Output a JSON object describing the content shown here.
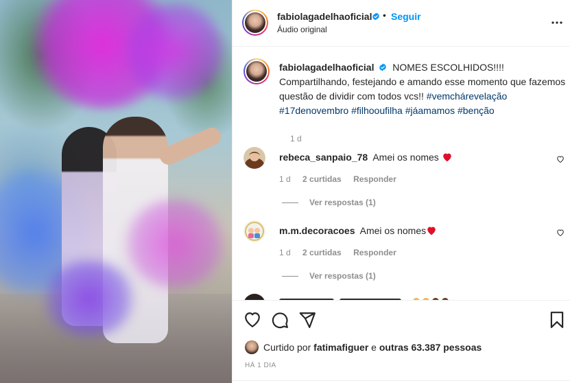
{
  "post": {
    "username": "fabiolagadelhaoficial",
    "follow_label": "Seguir",
    "separator": "•",
    "audio_label": "Áudio original"
  },
  "caption": {
    "username": "fabiolagadelhaoficial",
    "text": "NOMES ESCOLHIDOS!!!! Compartilhando, festejando e amando esse momento que fazemos questão de dividir com todos vcs!!",
    "hashtags": [
      "#vemchárevelação",
      "#17denovembro",
      "#filhooufilha",
      "#jáamamos",
      "#benção"
    ],
    "time": "1 d"
  },
  "comments": [
    {
      "username": "rebeca_sanpaio_78",
      "text": "Amei os nomes",
      "time": "1 d",
      "likes": "2 curtidas",
      "reply_label": "Responder",
      "replies_label": "Ver respostas (1)"
    },
    {
      "username": "m.m.decoracoes",
      "text": "Amei os nomes",
      "time": "1 d",
      "likes": "2 curtidas",
      "reply_label": "Responder",
      "replies_label": "Ver respostas (1)"
    }
  ],
  "likes_summary": {
    "prefix": "Curtido por",
    "user": "fatimafiguer",
    "connector": "e",
    "others": "outras 63.387 pessoas"
  },
  "date_label": "HÁ 1 DIA",
  "icons": {
    "heart": "heart-icon",
    "comment": "comment-icon",
    "share": "share-icon",
    "save": "bookmark-icon",
    "more": "more-options-icon",
    "verified": "verified-badge-icon"
  },
  "colors": {
    "link_blue": "#0095f6",
    "hashtag": "#00376b",
    "muted": "#8e8e8e",
    "heart_emoji": "#e0102b"
  }
}
